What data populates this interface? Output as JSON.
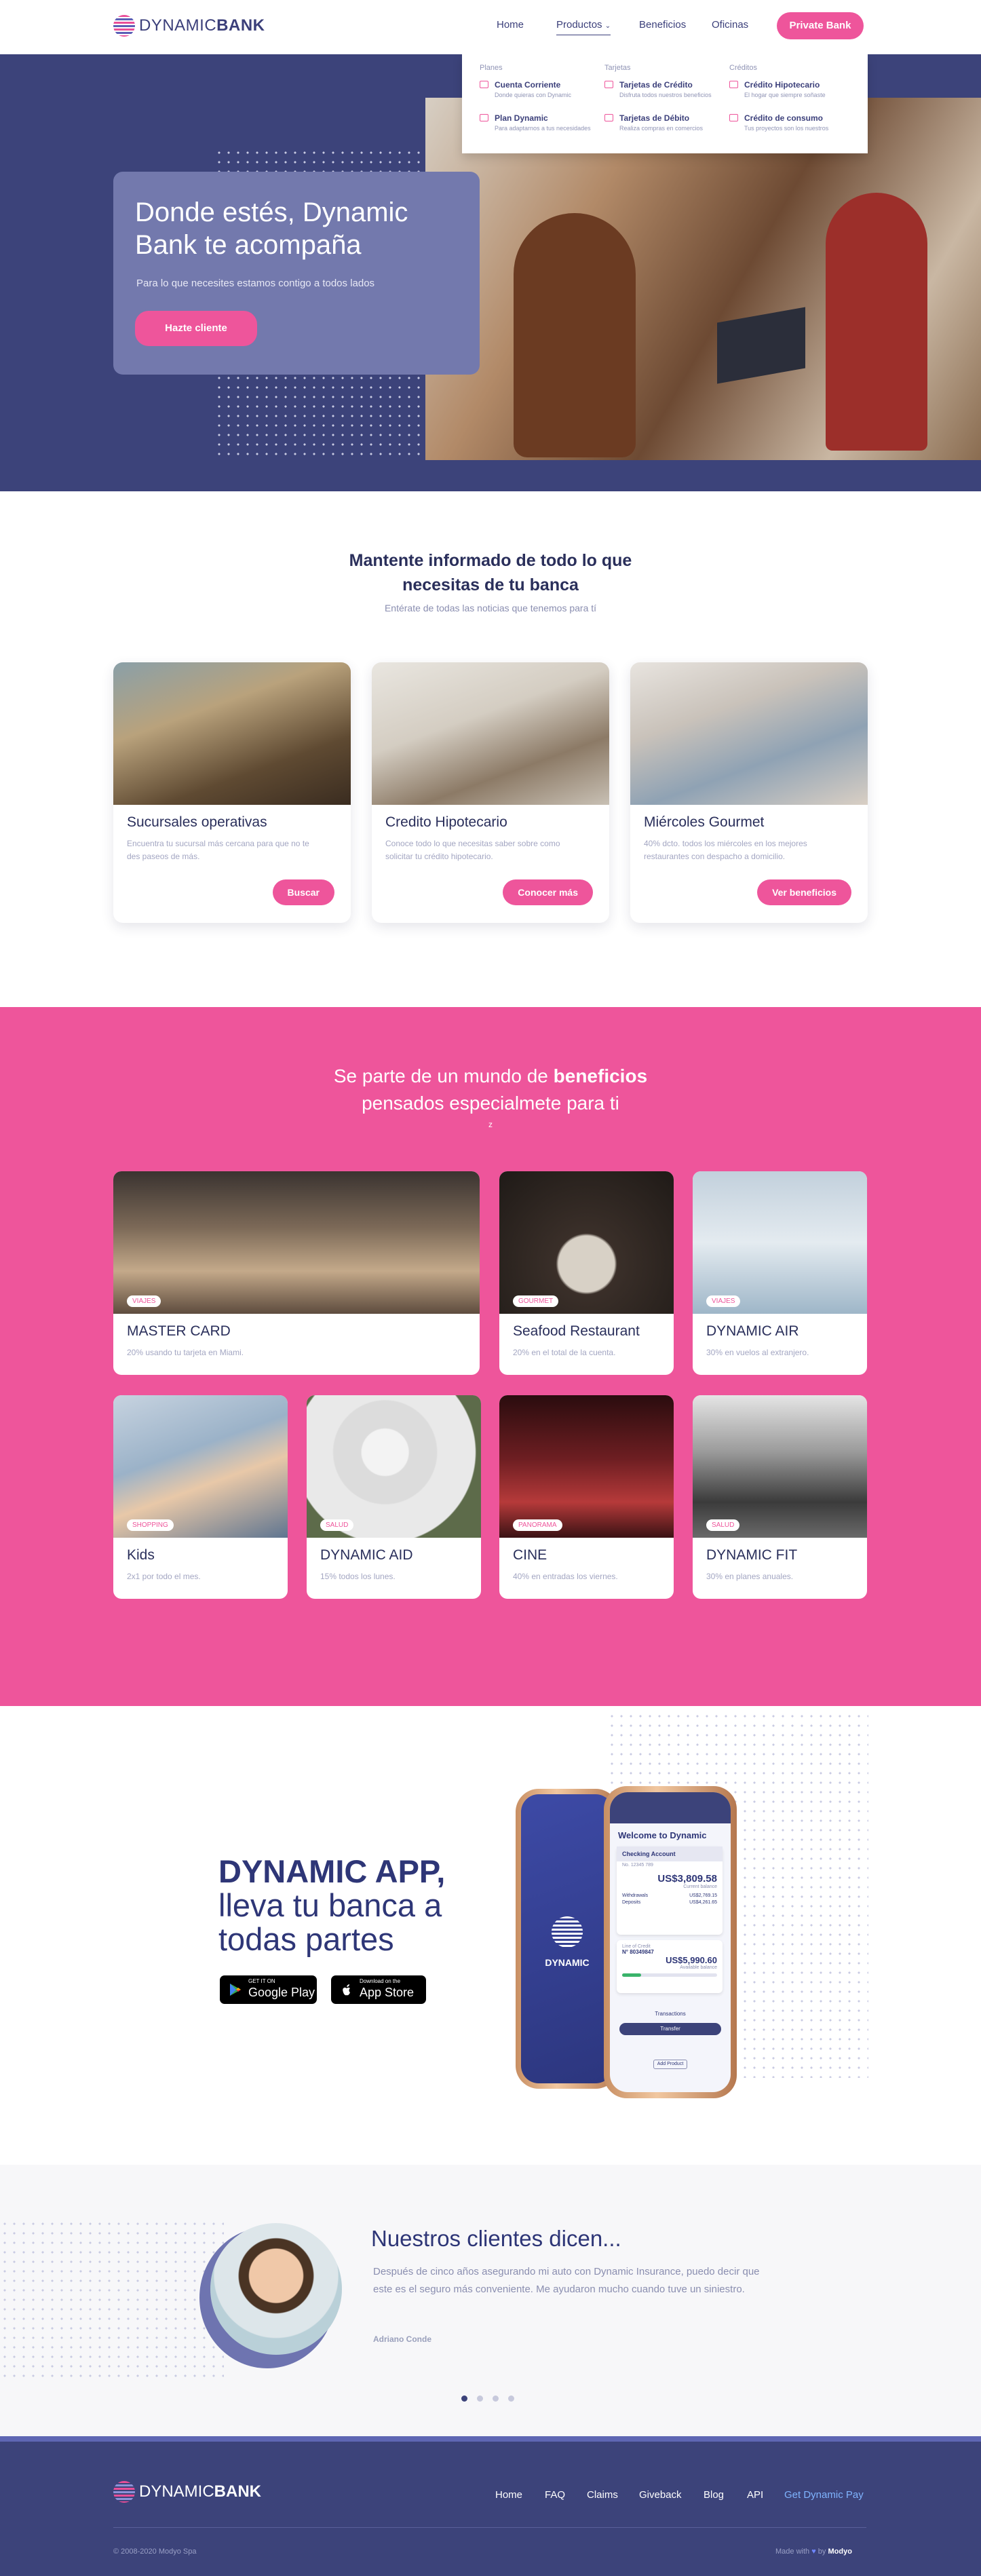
{
  "header": {
    "logo_regular": "DYNAMIC",
    "logo_bold": "BANK",
    "nav": [
      "Home",
      "Productos",
      "Beneficios",
      "Oficinas"
    ],
    "dropdown_arrow": "⌄",
    "private_button": "Private Bank"
  },
  "dropdown": {
    "columns": [
      {
        "category": "Planes",
        "items": [
          {
            "title": "Cuenta Corriente",
            "sub": "Donde quieras con Dynamic"
          },
          {
            "title": "Plan Dynamic",
            "sub": "Para adaptarnos a tus necesidades"
          }
        ]
      },
      {
        "category": "Tarjetas",
        "items": [
          {
            "title": "Tarjetas de Crédito",
            "sub": "Disfruta todos nuestros beneficios"
          },
          {
            "title": "Tarjetas de Débito",
            "sub": "Realiza compras en comercios"
          }
        ]
      },
      {
        "category": "Créditos",
        "items": [
          {
            "title": "Crédito Hipotecario",
            "sub": "El hogar que siempre soñaste"
          },
          {
            "title": "Crédito de consumo",
            "sub": "Tus proyectos son los nuestros"
          }
        ]
      }
    ]
  },
  "hero": {
    "title": "Donde estés, Dynamic Bank te acompaña",
    "subtitle": "Para lo que necesites estamos contigo a todos lados",
    "cta": "Hazte cliente"
  },
  "news": {
    "title": "Mantente informado de todo lo que necesitas de tu banca",
    "subtitle": "Entérate de todas las noticias que tenemos para tí",
    "cards": [
      {
        "title": "Sucursales operativas",
        "desc": "Encuentra tu sucursal más cercana para que no te des paseos de más.",
        "button": "Buscar"
      },
      {
        "title": "Credito Hipotecario",
        "desc": "Conoce todo lo que necesitas saber sobre como solicitar tu crédito hipotecario.",
        "button": "Conocer más"
      },
      {
        "title": "Miércoles Gourmet",
        "desc": "40% dcto. todos los miércoles en los mejores restaurantes con despacho a domicilio.",
        "button": "Ver beneficios"
      }
    ]
  },
  "benefits": {
    "title_pre": "Se parte de un mundo de ",
    "title_bold": "beneficios",
    "title_post": "pensados especialmete para ti",
    "small": "z",
    "cards": [
      {
        "tag": "VIAJES",
        "title": "MASTER CARD",
        "desc": "20% usando tu tarjeta en Miami."
      },
      {
        "tag": "GOURMET",
        "title": "Seafood Restaurant",
        "desc": "20% en el total de la cuenta."
      },
      {
        "tag": "VIAJES",
        "title": "DYNAMIC AIR",
        "desc": "30% en vuelos al extranjero."
      },
      {
        "tag": "SHOPPING",
        "title": "Kids",
        "desc": "2x1 por todo el mes."
      },
      {
        "tag": "SALUD",
        "title": "DYNAMIC AID",
        "desc": "15% todos los lunes."
      },
      {
        "tag": "PANORAMA",
        "title": "CINE",
        "desc": "40% en entradas los viernes."
      },
      {
        "tag": "SALUD",
        "title": "DYNAMIC FIT",
        "desc": "30% en planes anuales."
      }
    ]
  },
  "app": {
    "title_bold": "DYNAMIC APP,",
    "title_rest": "lleva tu banca a todas partes",
    "google_small": "GET IT ON",
    "google_large": "Google Play",
    "apple_small": "Download on the",
    "apple_large": "App Store",
    "phone": {
      "splash_label": "DYNAMIC",
      "welcome": "Welcome to Dynamic",
      "account": "Checking Account",
      "account_no": "No. 12345 789",
      "balance": "US$3,809.58",
      "balance_label": "Current balance",
      "rows": [
        [
          "Withdrawals",
          "US$2,769.15"
        ],
        [
          "Deposits",
          "US$4,261.65"
        ]
      ],
      "credit_label": "Line of Credit",
      "credit_no": "N° 80349847",
      "credit_amount": "US$5,990.60",
      "credit_sub": "Available balance",
      "transactions": "Transactions",
      "transfer": "Transfer",
      "add_product": "Add Product"
    }
  },
  "testimonials": {
    "title": "Nuestros clientes dicen...",
    "body": "Después de cinco años asegurando mi auto con Dynamic Insurance, puedo decir que este es el seguro más conveniente. Me ayudaron mucho cuando tuve un siniestro.",
    "name": "Adriano Conde",
    "dots": 4,
    "active": 0
  },
  "footer": {
    "logo_regular": "DYNAMIC",
    "logo_bold": "BANK",
    "links": [
      "Home",
      "FAQ",
      "Claims",
      "Giveback",
      "Blog",
      "API",
      "Get Dynamic Pay"
    ],
    "copyright": "© 2008-2020 Modyo Spa",
    "made_pre": "Made with",
    "made_by": "by",
    "made_brand": "Modyo",
    "accent": "#7fb4ff"
  },
  "colors": {
    "brand_navy": "#3c437a",
    "brand_pink": "#ee559b",
    "card_purple": "#7379ad"
  }
}
